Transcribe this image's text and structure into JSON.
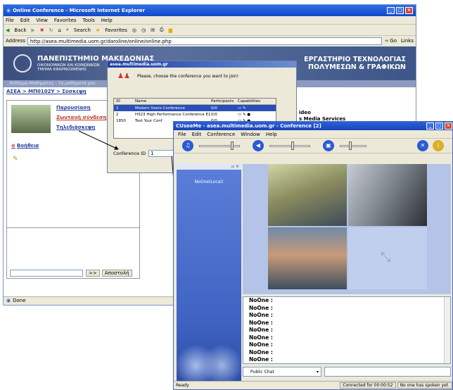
{
  "ie": {
    "title": "Online Conference - Microsoft Internet Explorer",
    "menu": [
      "File",
      "Edit",
      "View",
      "Favorites",
      "Tools",
      "Help"
    ],
    "toolbar": [
      "Back",
      "Search",
      "Favorites"
    ],
    "address_label": "Address",
    "address": "http://asea.multimedia.uom.gr/daroline/online/online.php",
    "go_label": "Go",
    "links_label": "Links",
    "status": "Done"
  },
  "site": {
    "title": "ΠΑΝΕΠΙΣΤΗΜΙΟ ΜΑΚΕΔΟΝΙΑΣ",
    "subtitle1": "ΟΙΚΟΝΟΜΙΚΩΝ ΚΑΙ ΚΟΙΝΩΝΙΚΩΝ",
    "subtitle2": "ΤΜΗΜΑ ΕΦΑΡΜΟΣΜΕΝΗΣ",
    "lab_line1": "ΕΡΓΑΣΤΗΡΙΟ ΤΕΧΝΟΛΟΓΙΑΣ",
    "lab_line2": "ΠΟΛΥΜΕΣΩΝ & ΓΡΑΦΙΚΩΝ",
    "strip": "Θεθόρμη Μαθήματος : Τα μαθήματά μου",
    "breadcrumb": "ΑΣΕΑ > ΜΠ0102Υ > Σύσκεψη",
    "links": [
      "Παρουσίαση",
      "Ζωντανή σύνδεση",
      "Τηλεδιάσκεψη"
    ],
    "help": "Βοήθεια",
    "side_text1": "ideo",
    "side_text2": "s Media Services",
    "btn_dots": ">>",
    "btn_send": "Αποστολή"
  },
  "dialog": {
    "title": "asea.multimedia.uom.gr",
    "prompt": "Please, choose the conference you want to join!",
    "columns": [
      "ID",
      "Name",
      "Participants",
      "Capabilities"
    ],
    "rows": [
      {
        "id": "1",
        "name": "Modern Users Conference",
        "participants": "0/0"
      },
      {
        "id": "2",
        "name": "H323 High Performance Conference E1",
        "participants": "0/0"
      },
      {
        "id": "1850",
        "name": "Test Your Conf",
        "participants": "0/0"
      }
    ],
    "conf_id_label": "Conference ID",
    "conf_id_value": "1"
  },
  "conf": {
    "title": "CUseeMe - asea.multimedia.uom.gr - Conference [2]",
    "menu": [
      "File",
      "Edit",
      "Conference",
      "Window",
      "Help"
    ],
    "participant": "NoOne(Local)",
    "chat_lines": [
      "NoOne :",
      "NoOne :",
      "NoOne :",
      "NoOne :",
      "NoOne :",
      "NoOne :",
      "NoOne :",
      "NoOne :",
      "NoOne :"
    ],
    "chat_mode": "Public Chat",
    "status_left": "Ready",
    "status_time": "Connected for 00:00:52",
    "status_speak": "No one has spoken yet."
  }
}
